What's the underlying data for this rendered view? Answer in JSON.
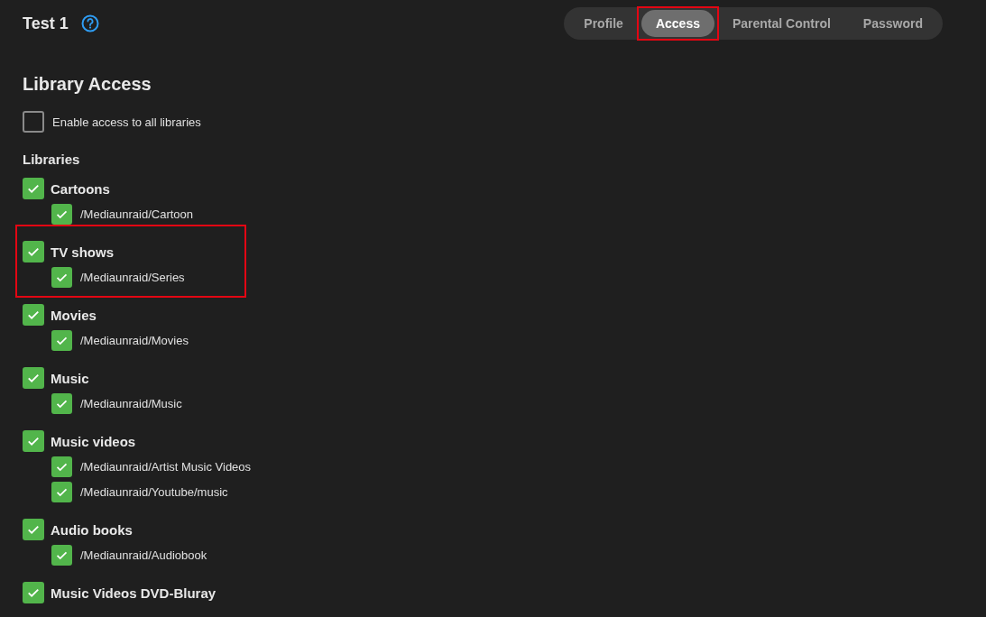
{
  "header": {
    "title": "Test 1"
  },
  "tabs": [
    {
      "label": "Profile",
      "selected": false,
      "highlighted": false
    },
    {
      "label": "Access",
      "selected": true,
      "highlighted": true
    },
    {
      "label": "Parental Control",
      "selected": false,
      "highlighted": false
    },
    {
      "label": "Password",
      "selected": false,
      "highlighted": false
    }
  ],
  "section": {
    "title": "Library Access",
    "enable_all": {
      "label": "Enable access to all libraries",
      "checked": false
    },
    "libraries_label": "Libraries"
  },
  "libraries": [
    {
      "name": "Cartoons",
      "checked": true,
      "highlighted": false,
      "folders": [
        {
          "path": "/Mediaunraid/Cartoon",
          "checked": true
        }
      ]
    },
    {
      "name": "TV shows",
      "checked": true,
      "highlighted": true,
      "folders": [
        {
          "path": "/Mediaunraid/Series",
          "checked": true
        }
      ]
    },
    {
      "name": "Movies",
      "checked": true,
      "highlighted": false,
      "folders": [
        {
          "path": "/Mediaunraid/Movies",
          "checked": true
        }
      ]
    },
    {
      "name": "Music",
      "checked": true,
      "highlighted": false,
      "folders": [
        {
          "path": "/Mediaunraid/Music",
          "checked": true
        }
      ]
    },
    {
      "name": "Music videos",
      "checked": true,
      "highlighted": false,
      "folders": [
        {
          "path": "/Mediaunraid/Artist Music Videos",
          "checked": true
        },
        {
          "path": "/Mediaunraid/Youtube/music",
          "checked": true
        }
      ]
    },
    {
      "name": "Audio books",
      "checked": true,
      "highlighted": false,
      "folders": [
        {
          "path": "/Mediaunraid/Audiobook",
          "checked": true
        }
      ]
    },
    {
      "name": "Music Videos DVD-Bluray",
      "checked": true,
      "highlighted": false
    }
  ]
}
